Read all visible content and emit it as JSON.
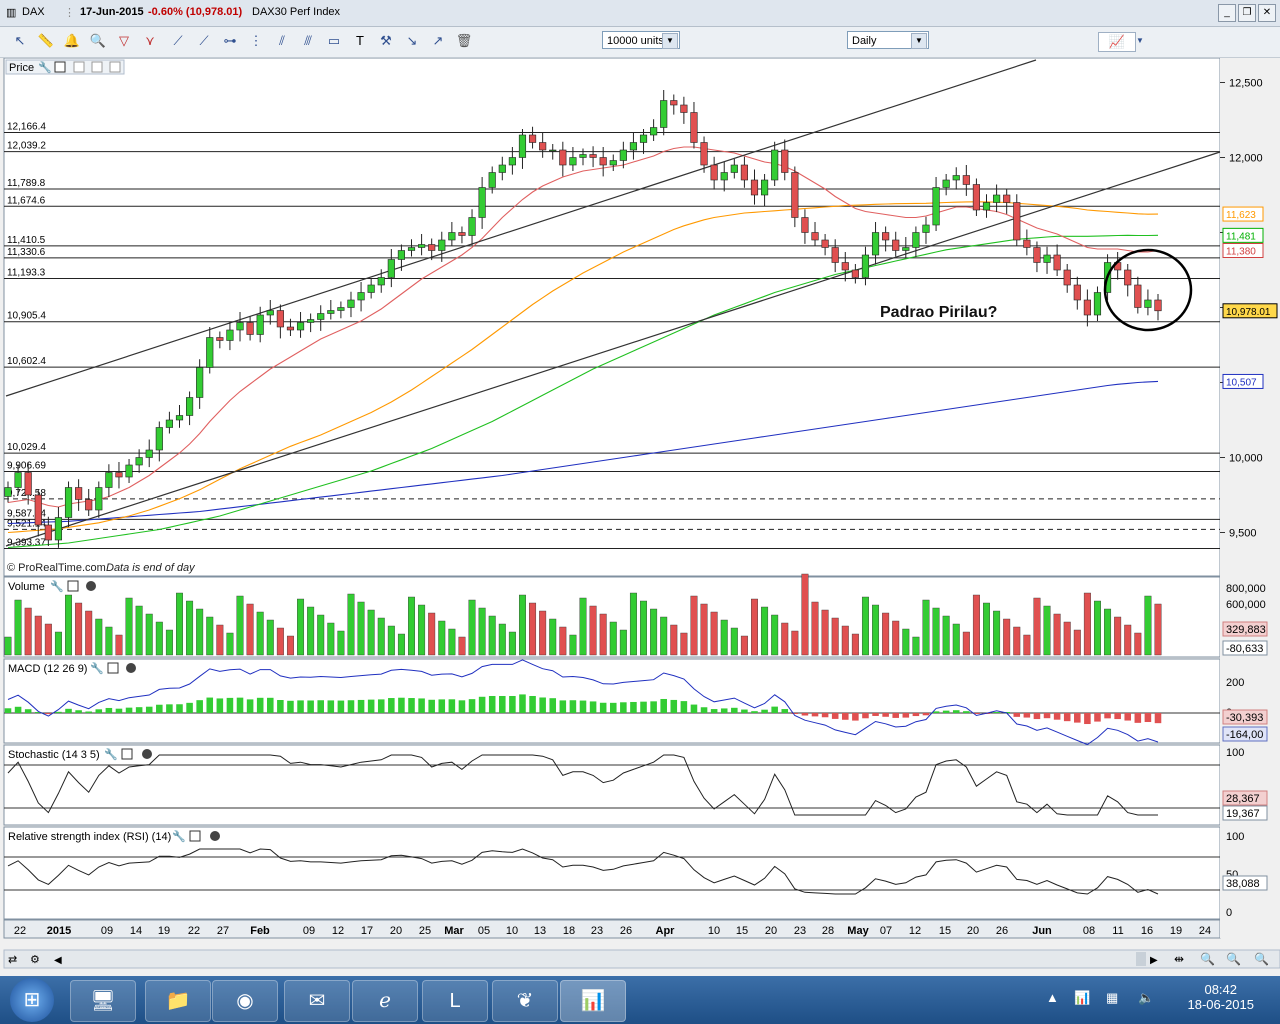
{
  "window": {
    "symbol": "DAX",
    "date": "17-Jun-2015",
    "change": "-0.60% (10,978.01)",
    "description": "DAX30 Perf Index"
  },
  "toolbar": {
    "units_value": "10000 units",
    "period_value": "Daily"
  },
  "panels": {
    "price_label": "Price",
    "watermark": "© ProRealTime.com",
    "eod_note": "Data is end of day",
    "annotation": "Padrao Pirilau?",
    "volume_label": "Volume",
    "macd_label": "MACD (12 26 9)",
    "stoch_label": "Stochastic (14 3 5)",
    "rsi_label": "Relative strength index (RSI) (14)"
  },
  "price_axis": {
    "ticks": [
      "12,500",
      "12,000",
      "11,500",
      "11,000",
      "10,500",
      "10,000",
      "9,500"
    ],
    "tick_values": [
      12500,
      12000,
      11500,
      11000,
      10500,
      10000,
      9500
    ]
  },
  "horizontal_levels": [
    {
      "label": "12,166.4",
      "value": 12166.4
    },
    {
      "label": "12,039.2",
      "value": 12039.2
    },
    {
      "label": "11,789.8",
      "value": 11789.8
    },
    {
      "label": "11,674.6",
      "value": 11674.6
    },
    {
      "label": "11,410.5",
      "value": 11410.5
    },
    {
      "label": "11,330.6",
      "value": 11330.6
    },
    {
      "label": "11,193.3",
      "value": 11193.3
    },
    {
      "label": "10,905.4",
      "value": 10905.4
    },
    {
      "label": "10,602.4",
      "value": 10602.4
    },
    {
      "label": "10,029.4",
      "value": 10029.4
    },
    {
      "label": "9,906.69",
      "value": 9906.69
    },
    {
      "label": "9,724.58",
      "value": 9724.58
    },
    {
      "label": "9,587.14",
      "value": 9587.14
    },
    {
      "label": "9,521.14",
      "value": 9521.14
    },
    {
      "label": "9,393.37",
      "value": 9393.37
    }
  ],
  "price_badges": [
    {
      "label": "11,623",
      "value": 11623,
      "color": "#ff9900"
    },
    {
      "label": "11,481",
      "value": 11481,
      "color": "#00b000"
    },
    {
      "label": "11,380",
      "value": 11380,
      "color": "#d04040"
    },
    {
      "label": "10,978.01",
      "value": 10978.01,
      "color": "#000000"
    },
    {
      "label": "10,507",
      "value": 10507,
      "color": "#2030c0"
    }
  ],
  "volume_axis": [
    "800,000",
    "600,000"
  ],
  "volume_badges": [
    "329,883",
    "-80,633"
  ],
  "macd_axis": [
    "200",
    "0"
  ],
  "macd_badges": [
    "-30,393",
    "-164,00"
  ],
  "stoch_axis": [
    "100",
    "0"
  ],
  "stoch_badges": [
    "28,367",
    "19,367"
  ],
  "rsi_axis": [
    "100",
    "50",
    "0"
  ],
  "rsi_badges": [
    "38,088"
  ],
  "date_axis": [
    "22",
    "2015",
    "09",
    "14",
    "19",
    "22",
    "27",
    "Feb",
    "09",
    "12",
    "17",
    "20",
    "25",
    "Mar",
    "05",
    "10",
    "13",
    "18",
    "23",
    "26",
    "Apr",
    "10",
    "15",
    "20",
    "23",
    "28",
    "May",
    "07",
    "12",
    "15",
    "20",
    "26",
    "Jun",
    "08",
    "11",
    "16",
    "19",
    "24"
  ],
  "clock": {
    "time": "08:42",
    "date": "18-06-2015"
  },
  "chart_data": {
    "type": "candlestick",
    "symbol": "DAX",
    "ylim": [
      9250,
      12650
    ],
    "closes": [
      9800,
      9900,
      9750,
      9550,
      9450,
      9600,
      9800,
      9720,
      9650,
      9800,
      9900,
      9870,
      9950,
      10000,
      10050,
      10200,
      10250,
      10280,
      10400,
      10600,
      10800,
      10780,
      10850,
      10900,
      10820,
      10950,
      10980,
      10870,
      10850,
      10900,
      10920,
      10960,
      10980,
      11000,
      11050,
      11100,
      11150,
      11200,
      11320,
      11380,
      11400,
      11420,
      11380,
      11450,
      11500,
      11480,
      11600,
      11800,
      11900,
      11950,
      12000,
      12150,
      12100,
      12050,
      12050,
      11950,
      12000,
      12020,
      12000,
      11950,
      11980,
      12050,
      12100,
      12150,
      12200,
      12380,
      12350,
      12300,
      12100,
      11950,
      11850,
      11900,
      11950,
      11850,
      11750,
      11850,
      12050,
      11900,
      11600,
      11500,
      11450,
      11400,
      11300,
      11250,
      11200,
      11350,
      11500,
      11450,
      11380,
      11400,
      11500,
      11550,
      11800,
      11850,
      11880,
      11820,
      11650,
      11700,
      11750,
      11700,
      11450,
      11400,
      11300,
      11350,
      11250,
      11150,
      11050,
      10950,
      11100,
      11300,
      11250,
      11150,
      11000,
      11050,
      10978
    ],
    "ma_red": [
      9700,
      9710,
      9720,
      9700,
      9680,
      9670,
      9690,
      9700,
      9710,
      9720,
      9740,
      9770,
      9800,
      9840,
      9880,
      9930,
      9980,
      10030,
      10090,
      10160,
      10240,
      10310,
      10380,
      10440,
      10490,
      10540,
      10590,
      10630,
      10670,
      10710,
      10750,
      10790,
      10820,
      10850,
      10880,
      10910,
      10950,
      10990,
      11040,
      11090,
      11140,
      11190,
      11230,
      11270,
      11310,
      11350,
      11400,
      11460,
      11530,
      11600,
      11660,
      11720,
      11770,
      11810,
      11840,
      11870,
      11890,
      11910,
      11920,
      11930,
      11940,
      11950,
      11970,
      11990,
      12010,
      12040,
      12060,
      12070,
      12070,
      12060,
      12050,
      12040,
      12030,
      12010,
      11990,
      11970,
      11960,
      11940,
      11910,
      11870,
      11830,
      11790,
      11740,
      11700,
      11660,
      11640,
      11630,
      11620,
      11610,
      11600,
      11600,
      11610,
      11630,
      11650,
      11670,
      11670,
      11660,
      11650,
      11640,
      11620,
      11590,
      11560,
      11530,
      11510,
      11490,
      11460,
      11430,
      11400,
      11390,
      11390,
      11390,
      11380,
      11370,
      11370,
      11380
    ],
    "ma_orange": [
      9500,
      9505,
      9510,
      9515,
      9520,
      9525,
      9535,
      9545,
      9555,
      9565,
      9580,
      9595,
      9610,
      9630,
      9650,
      9675,
      9700,
      9725,
      9755,
      9785,
      9820,
      9855,
      9890,
      9925,
      9955,
      9985,
      10015,
      10045,
      10075,
      10100,
      10125,
      10150,
      10180,
      10210,
      10240,
      10270,
      10300,
      10335,
      10370,
      10410,
      10450,
      10495,
      10540,
      10585,
      10630,
      10675,
      10720,
      10770,
      10820,
      10870,
      10920,
      10970,
      11020,
      11065,
      11110,
      11150,
      11190,
      11230,
      11265,
      11300,
      11335,
      11370,
      11400,
      11430,
      11460,
      11490,
      11520,
      11545,
      11565,
      11585,
      11600,
      11610,
      11620,
      11630,
      11635,
      11640,
      11645,
      11650,
      11655,
      11660,
      11665,
      11670,
      11675,
      11680,
      11682,
      11685,
      11688,
      11690,
      11692,
      11693,
      11694,
      11695,
      11697,
      11700,
      11702,
      11704,
      11705,
      11704,
      11702,
      11700,
      11695,
      11690,
      11685,
      11680,
      11675,
      11668,
      11660,
      11650,
      11645,
      11640,
      11635,
      11630,
      11625,
      11622,
      11623
    ],
    "ma_green": [
      9400,
      9405,
      9410,
      9415,
      9420,
      9425,
      9430,
      9440,
      9450,
      9460,
      9470,
      9480,
      9490,
      9500,
      9510,
      9520,
      9535,
      9550,
      9565,
      9580,
      9595,
      9610,
      9630,
      9650,
      9670,
      9690,
      9710,
      9730,
      9750,
      9770,
      9790,
      9810,
      9830,
      9850,
      9870,
      9890,
      9910,
      9935,
      9960,
      9985,
      10010,
      10035,
      10060,
      10090,
      10120,
      10150,
      10180,
      10210,
      10240,
      10275,
      10310,
      10345,
      10380,
      10415,
      10450,
      10485,
      10520,
      10555,
      10590,
      10620,
      10650,
      10680,
      10710,
      10740,
      10770,
      10800,
      10830,
      10860,
      10890,
      10920,
      10950,
      10975,
      11000,
      11025,
      11050,
      11075,
      11100,
      11120,
      11140,
      11160,
      11180,
      11200,
      11220,
      11235,
      11250,
      11265,
      11280,
      11295,
      11310,
      11325,
      11340,
      11355,
      11370,
      11385,
      11395,
      11405,
      11415,
      11425,
      11435,
      11445,
      11455,
      11460,
      11465,
      11470,
      11475,
      11475,
      11475,
      11475,
      11476,
      11478,
      11480,
      11481,
      11480,
      11480,
      11481
    ],
    "ma_blue": [
      9560,
      9562,
      9565,
      9568,
      9570,
      9572,
      9575,
      9580,
      9585,
      9590,
      9595,
      9600,
      9605,
      9610,
      9615,
      9620,
      9625,
      9630,
      9635,
      9640,
      9648,
      9656,
      9664,
      9672,
      9680,
      9688,
      9696,
      9704,
      9712,
      9720,
      9728,
      9736,
      9744,
      9752,
      9760,
      9768,
      9776,
      9784,
      9792,
      9800,
      9808,
      9816,
      9824,
      9832,
      9840,
      9848,
      9856,
      9864,
      9872,
      9880,
      9890,
      9900,
      9910,
      9920,
      9930,
      9940,
      9950,
      9960,
      9970,
      9980,
      9990,
      10000,
      10010,
      10020,
      10030,
      10040,
      10050,
      10060,
      10070,
      10080,
      10090,
      10100,
      10110,
      10120,
      10130,
      10140,
      10150,
      10160,
      10170,
      10180,
      10190,
      10200,
      10210,
      10220,
      10230,
      10240,
      10250,
      10260,
      10270,
      10280,
      10290,
      10300,
      10310,
      10320,
      10330,
      10340,
      10350,
      10360,
      10370,
      10380,
      10390,
      10400,
      10410,
      10420,
      10430,
      10440,
      10450,
      10460,
      10470,
      10480,
      10488,
      10494,
      10500,
      10504,
      10507
    ]
  },
  "colors": {
    "up": "#33cc33",
    "down": "#e05050",
    "panel_bg": "#ffffff",
    "panel_border": "#8090a0"
  }
}
